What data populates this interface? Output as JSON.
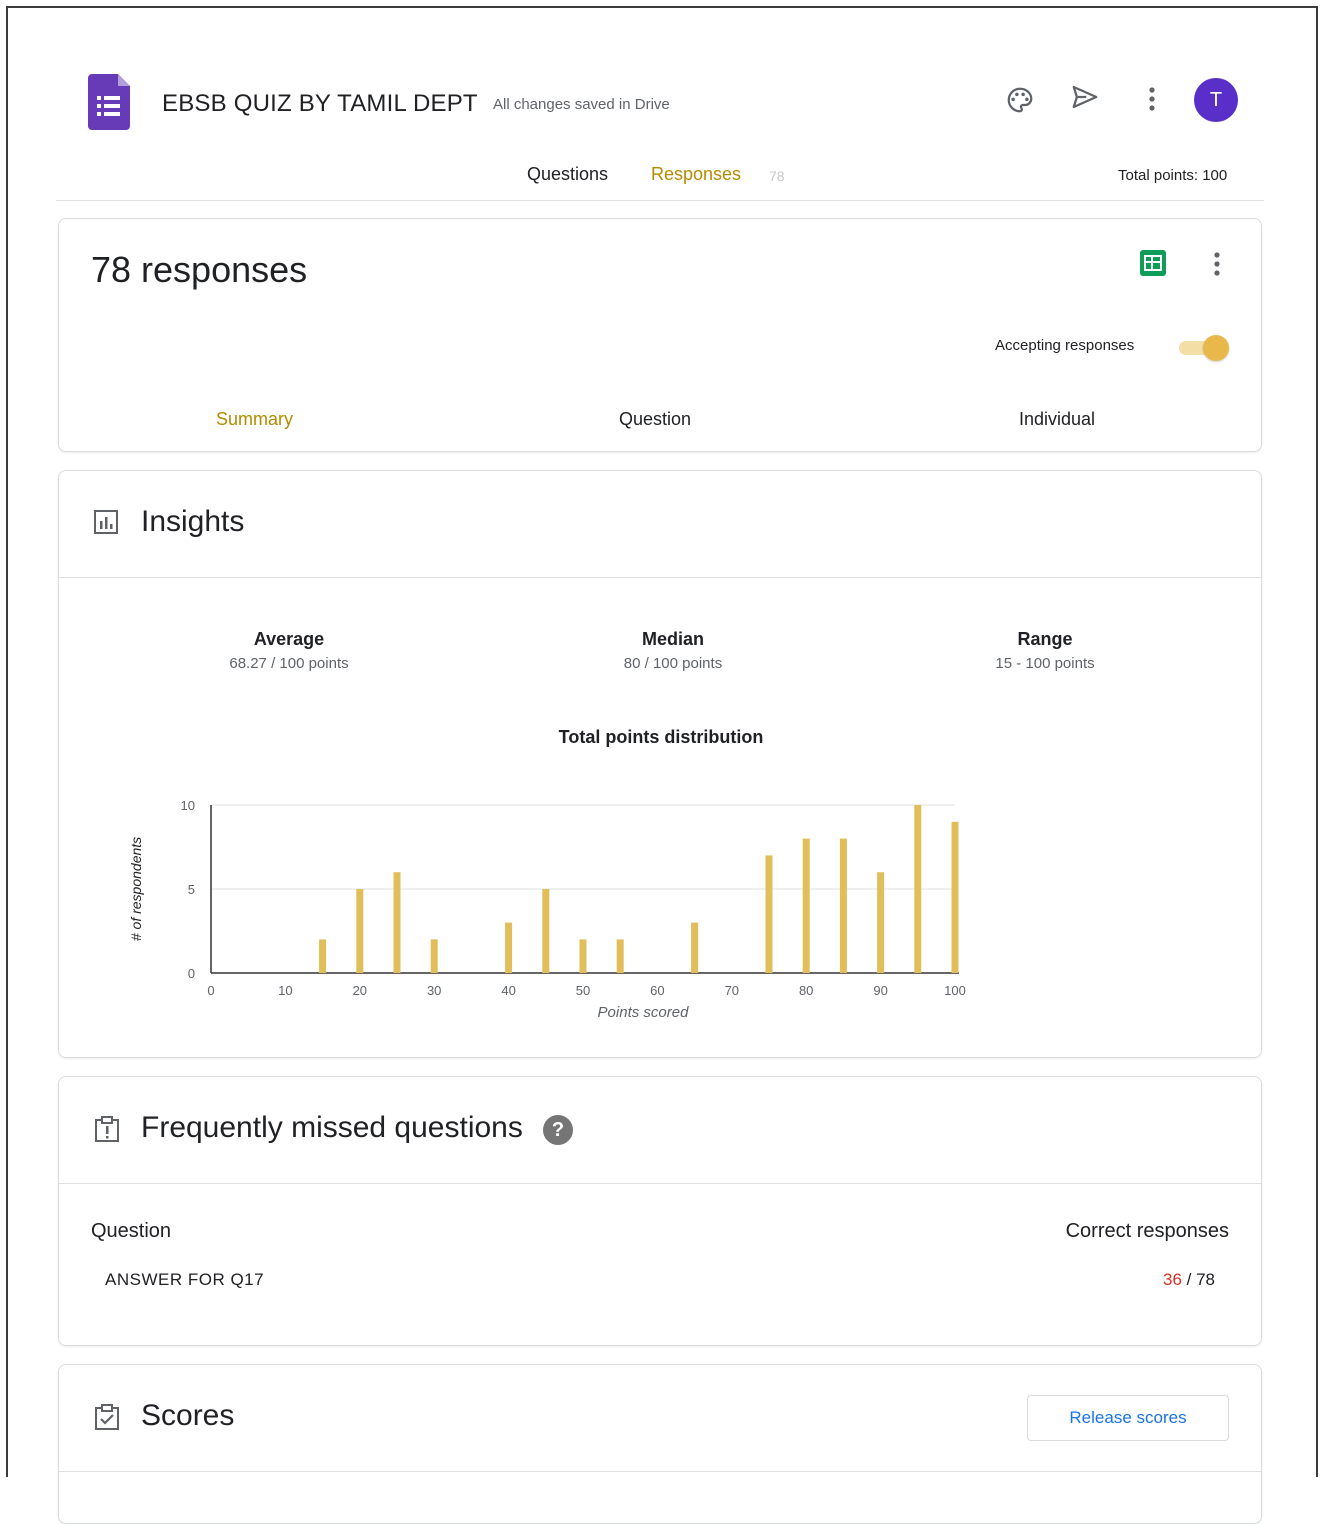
{
  "header": {
    "title": "EBSB QUIZ BY TAMIL DEPT",
    "saved_status": "All changes saved in Drive",
    "avatar_letter": "T",
    "icons": [
      "palette-icon",
      "send-icon",
      "more-vert-icon"
    ]
  },
  "tabs": {
    "questions": "Questions",
    "responses": "Responses",
    "responses_count": "78",
    "total_points": "Total points: 100"
  },
  "responses_card": {
    "count_label": "78 responses",
    "accepting_label": "Accepting responses",
    "accepting_on": true,
    "subtabs": [
      "Summary",
      "Question",
      "Individual"
    ]
  },
  "insights": {
    "title": "Insights",
    "stats": [
      {
        "label": "Average",
        "value": "68.27 / 100 points"
      },
      {
        "label": "Median",
        "value": "80 / 100 points"
      },
      {
        "label": "Range",
        "value": "15 - 100 points"
      }
    ]
  },
  "chart_data": {
    "type": "bar",
    "title": "Total points distribution",
    "xlabel": "Points scored",
    "ylabel": "# of respondents",
    "xlim": [
      0,
      100
    ],
    "ylim": [
      0,
      10
    ],
    "xticks": [
      0,
      10,
      20,
      30,
      40,
      50,
      60,
      70,
      80,
      90,
      100
    ],
    "yticks": [
      0,
      5,
      10
    ],
    "x": [
      15,
      20,
      25,
      30,
      40,
      45,
      50,
      55,
      65,
      75,
      80,
      85,
      90,
      95,
      100
    ],
    "values": [
      2,
      5,
      6,
      2,
      3,
      5,
      2,
      2,
      3,
      7,
      8,
      8,
      6,
      10,
      9
    ],
    "bar_color": "#e2be5a"
  },
  "missed": {
    "title": "Frequently missed questions",
    "col_question": "Question",
    "col_correct": "Correct responses",
    "rows": [
      {
        "question": "ANSWER FOR Q17",
        "correct": "36",
        "total": "/ 78"
      }
    ]
  },
  "scores": {
    "title": "Scores",
    "release_label": "Release scores"
  },
  "colors": {
    "accent": "#b38b00",
    "purple": "#673ab7",
    "sheets_green": "#0f9d58",
    "toggle": "#e8b84a",
    "error_red": "#d93025",
    "link_blue": "#1a73e8"
  }
}
